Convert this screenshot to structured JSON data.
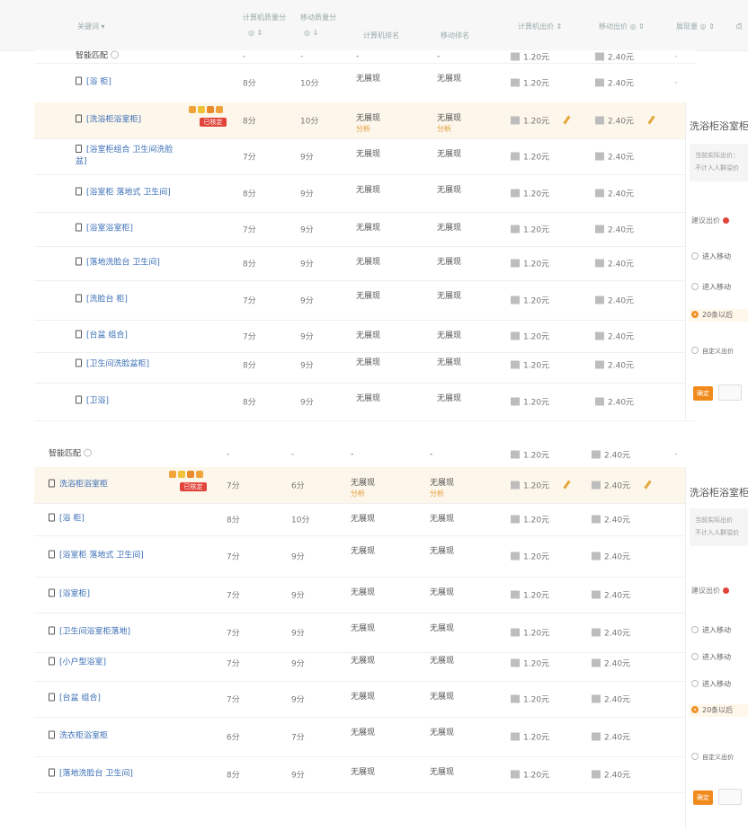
{
  "header": {
    "col_keyword": "关键词 ▾",
    "col_pc_quality": "计算机质量分",
    "col_pc_quality_sub": "◎ ⇕",
    "col_mobile_quality": "移动质量分",
    "col_mobile_quality_sub": "◎ ⇓",
    "col_pc_rank": "计算机排名",
    "col_mobile_rank": "移动排名",
    "col_pc_price": "计算机出价 ⇕",
    "col_mobile_price": "移动出价 ◎ ⇕",
    "col_volume": "展现量 ◎ ⇕",
    "col_extra": "点"
  },
  "smart_match_label": "智能匹配",
  "section1": [
    {
      "keyword": "智能匹配",
      "q1": "-",
      "q2": "-",
      "s1": "-",
      "s2": "-",
      "p1": "1.20元",
      "p2": "2.40元",
      "vol": "-",
      "type": "group"
    },
    {
      "keyword": "[浴 柜]",
      "q1": "8分",
      "q2": "10分",
      "s1": "无展现",
      "s2": "无展现",
      "p1": "1.20元",
      "p2": "2.40元",
      "vol": "-"
    },
    {
      "keyword": "[洗浴柜浴室柜]",
      "q1": "8分",
      "q2": "10分",
      "s1": "无展现",
      "s2": "无展现",
      "s1_sub": "分析",
      "s2_sub": "分析",
      "p1": "1.20元",
      "p2": "2.40元",
      "type": "highlight",
      "badge": "已核定"
    },
    {
      "keyword": "[浴室柜组合 卫生间洗脸盆]",
      "q1": "7分",
      "q2": "9分",
      "s1": "无展现",
      "s2": "无展现",
      "p1": "1.20元",
      "p2": "2.40元"
    },
    {
      "keyword": "[浴室柜 落地式 卫生间]",
      "q1": "8分",
      "q2": "9分",
      "s1": "无展现",
      "s2": "无展现",
      "p1": "1.20元",
      "p2": "2.40元"
    },
    {
      "keyword": "[浴室浴室柜]",
      "q1": "7分",
      "q2": "9分",
      "s1": "无展现",
      "s2": "无展现",
      "p1": "1.20元",
      "p2": "2.40元"
    },
    {
      "keyword": "[落地洗脸台 卫生间]",
      "q1": "8分",
      "q2": "9分",
      "s1": "无展现",
      "s2": "无展现",
      "p1": "1.20元",
      "p2": "2.40元"
    },
    {
      "keyword": "[洗脸台 柜]",
      "q1": "7分",
      "q2": "9分",
      "s1": "无展现",
      "s2": "无展现",
      "p1": "1.20元",
      "p2": "2.40元"
    },
    {
      "keyword": "[台盆 组合]",
      "q1": "7分",
      "q2": "9分",
      "s1": "无展现",
      "s2": "无展现",
      "p1": "1.20元",
      "p2": "2.40元"
    },
    {
      "keyword": "[卫生间洗脸盆柜]",
      "q1": "8分",
      "q2": "9分",
      "s1": "无展现",
      "s2": "无展现",
      "p1": "1.20元",
      "p2": "2.40元"
    },
    {
      "keyword": "[卫浴]",
      "q1": "8分",
      "q2": "9分",
      "s1": "无展现",
      "s2": "无展现",
      "p1": "1.20元",
      "p2": "2.40元"
    }
  ],
  "section2": [
    {
      "keyword": "智能匹配",
      "q1": "-",
      "q2": "-",
      "s1": "-",
      "s2": "-",
      "p1": "1.20元",
      "p2": "2.40元",
      "vol": "-",
      "type": "group"
    },
    {
      "keyword": "洗浴柜浴室柜",
      "q1": "7分",
      "q2": "6分",
      "s1": "无展现",
      "s2": "无展现",
      "s1_sub": "分析",
      "s2_sub": "分析",
      "p1": "1.20元",
      "p2": "2.40元",
      "type": "highlight",
      "badge": "已核定"
    },
    {
      "keyword": "[浴 柜]",
      "q1": "8分",
      "q2": "10分",
      "s1": "无展现",
      "s2": "无展现",
      "p1": "1.20元",
      "p2": "2.40元"
    },
    {
      "keyword": "[浴室柜 落地式 卫生间]",
      "q1": "7分",
      "q2": "9分",
      "s1": "无展现",
      "s2": "无展现",
      "p1": "1.20元",
      "p2": "2.40元"
    },
    {
      "keyword": "[浴室柜]",
      "q1": "7分",
      "q2": "9分",
      "s1": "无展现",
      "s2": "无展现",
      "p1": "1.20元",
      "p2": "2.40元"
    },
    {
      "keyword": "[卫生间浴室柜落地]",
      "q1": "7分",
      "q2": "9分",
      "s1": "无展现",
      "s2": "无展现",
      "p1": "1.20元",
      "p2": "2.40元"
    },
    {
      "keyword": "[小户型浴室]",
      "q1": "7分",
      "q2": "9分",
      "s1": "无展现",
      "s2": "无展现",
      "p1": "1.20元",
      "p2": "2.40元"
    },
    {
      "keyword": "[台盆 组合]",
      "q1": "7分",
      "q2": "9分",
      "s1": "无展现",
      "s2": "无展现",
      "p1": "1.20元",
      "p2": "2.40元"
    },
    {
      "keyword": "洗衣柜浴室柜",
      "q1": "6分",
      "q2": "7分",
      "s1": "无展现",
      "s2": "无展现",
      "p1": "1.20元",
      "p2": "2.40元"
    },
    {
      "keyword": "[落地洗脸台 卫生间]",
      "q1": "8分",
      "q2": "9分",
      "s1": "无展现",
      "s2": "无展现",
      "p1": "1.20元",
      "p2": "2.40元"
    }
  ],
  "panel1": {
    "title": "洗浴柜浴室柜",
    "current_line1": "当前实际出价：",
    "current_line2": "不计入人群溢价",
    "suggest_label": "建议出价",
    "opt1": "进入移动",
    "opt2": "进入移动",
    "opt3": "20条以后",
    "custom": "自定义出价",
    "ok": "确定"
  },
  "panel2": {
    "title": "洗浴柜浴室柜",
    "current_line1": "当前实际出价",
    "current_line2": "不计入人群溢价",
    "suggest_label": "建议出价",
    "opt1": "进入移动",
    "opt2": "进入移动",
    "opt3": "进入移动",
    "opt4": "20条以后",
    "custom": "自定义出价",
    "ok": "确定"
  },
  "colors": {
    "accent": "#f08a1c",
    "badge": "#e0443b",
    "link": "#3b6fb6",
    "highlight": "#fdf6ea"
  }
}
